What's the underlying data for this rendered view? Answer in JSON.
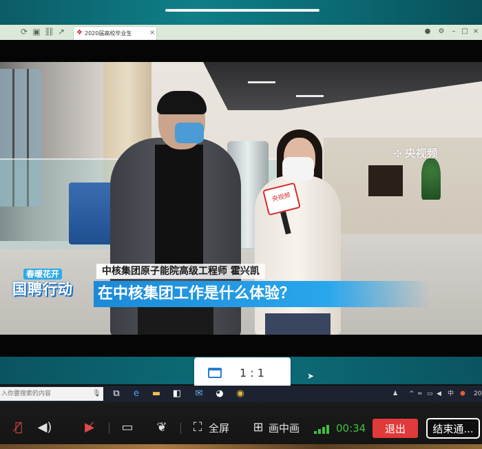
{
  "browser": {
    "tab_title": "2020届高校毕业生",
    "tab_close": "×"
  },
  "video": {
    "watermark": "央视频",
    "program_logo_top": "春暖花开",
    "program_logo_main": "国聘行动",
    "mic_label": "央视频",
    "caption_name": "中核集团原子能院高级工程师 霍兴凯",
    "caption_question": "在中核集团工作是什么体验？"
  },
  "ratio_popup": {
    "ratio": "1 : 1"
  },
  "taskbar": {
    "search_placeholder": "入你要搜索的内容",
    "tray_lang": "中",
    "tray_year": "20"
  },
  "controls": {
    "fullscreen_label": "全屏",
    "pip_label": "画中画",
    "timer": "00:34",
    "exit_label": "退出",
    "end_label": "结束通..."
  },
  "colors": {
    "exit_red": "#e03a3a",
    "caption_blue": "#1b8ad8",
    "signal_green": "#3ec13e",
    "desktop_teal": "#0c6f7a"
  },
  "icons": [
    "mic-muted-icon",
    "speaker-icon",
    "camera-off-icon",
    "screen-share-icon",
    "effects-icon",
    "fullscreen-icon",
    "pip-icon",
    "signal-icon"
  ]
}
